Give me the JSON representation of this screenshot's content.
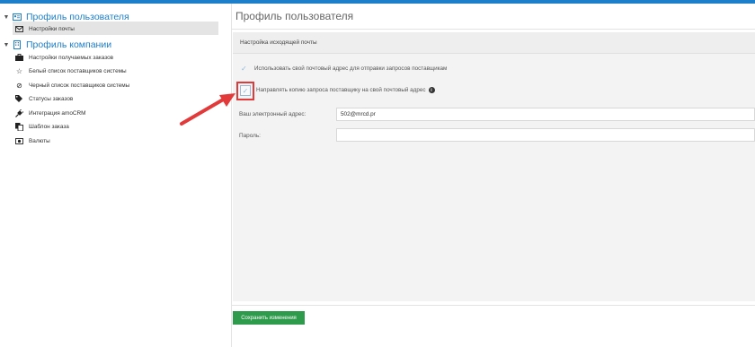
{
  "sidebar": {
    "user_profile": {
      "label": "Профиль пользователя",
      "items": [
        {
          "label": "Настройки почты",
          "icon": "envelope-icon"
        }
      ]
    },
    "company_profile": {
      "label": "Профиль компании",
      "items": [
        {
          "label": "Настройки получаемых заказов",
          "icon": "briefcase-icon"
        },
        {
          "label": "Белый список поставщиков системы",
          "icon": "star-icon"
        },
        {
          "label": "Черный список поставщиков системы",
          "icon": "ban-icon"
        },
        {
          "label": "Статусы заказов",
          "icon": "tags-icon"
        },
        {
          "label": "Интеграция amoCRM",
          "icon": "plug-icon"
        },
        {
          "label": "Шаблон заказа",
          "icon": "copy-icon"
        },
        {
          "label": "Валюты",
          "icon": "money-icon"
        }
      ]
    }
  },
  "main": {
    "title": "Профиль пользователя",
    "panel_title": "Настройка исходящей почты",
    "use_own_email_label": "Использовать свой почтовый адрес для отправки запросов поставщикам",
    "send_copy_label": "Направлять копию запроса поставщику на свой почтовый адрес",
    "email_label": "Ваш электронный адрес:",
    "email_value": "502@mrcd.pr",
    "password_label": "Пароль:",
    "password_value": "",
    "save_button": "Сохранить изменения"
  },
  "colors": {
    "accent": "#1d7fc9",
    "save_button": "#2e9b4c",
    "highlight": "#e23a3a"
  }
}
